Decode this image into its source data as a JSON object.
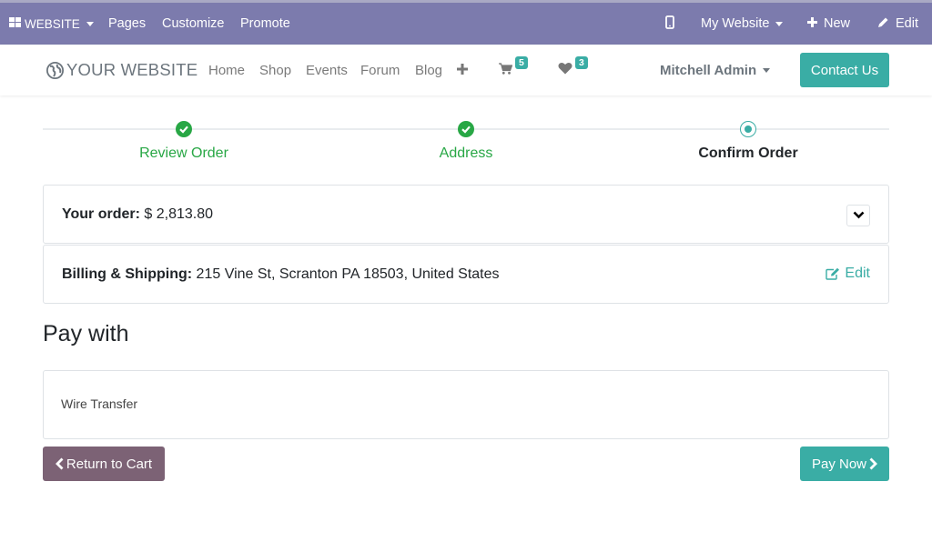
{
  "admin_bar": {
    "website_label": "WEBSITE",
    "pages_label": "Pages",
    "customize_label": "Customize",
    "promote_label": "Promote",
    "mobile_icon": "mobile-icon",
    "my_website_label": "My Website",
    "new_label": "New",
    "edit_label": "Edit"
  },
  "navbar": {
    "logo_text": "YOUR WEBSITE",
    "links": [
      "Home",
      "Shop",
      "Events",
      "Forum",
      "Blog"
    ],
    "cart_count": "5",
    "wishlist_count": "3",
    "user_name": "Mitchell Admin",
    "contact_label": "Contact Us"
  },
  "wizard": {
    "steps": [
      {
        "label": "Review Order",
        "state": "done"
      },
      {
        "label": "Address",
        "state": "done"
      },
      {
        "label": "Confirm Order",
        "state": "current"
      }
    ]
  },
  "order": {
    "label": "Your order:",
    "amount": "$ 2,813.80"
  },
  "billing": {
    "label": "Billing & Shipping:",
    "address": "215 Vine St, Scranton PA 18503, United States",
    "edit_label": "Edit"
  },
  "payment": {
    "heading": "Pay with",
    "method": "Wire Transfer"
  },
  "actions": {
    "back_label": "Return to Cart",
    "pay_label": "Pay Now"
  },
  "colors": {
    "admin_bar": "#7c7bad",
    "accent": "#3aada5",
    "success": "#28a745",
    "back_button": "#7c6275"
  }
}
